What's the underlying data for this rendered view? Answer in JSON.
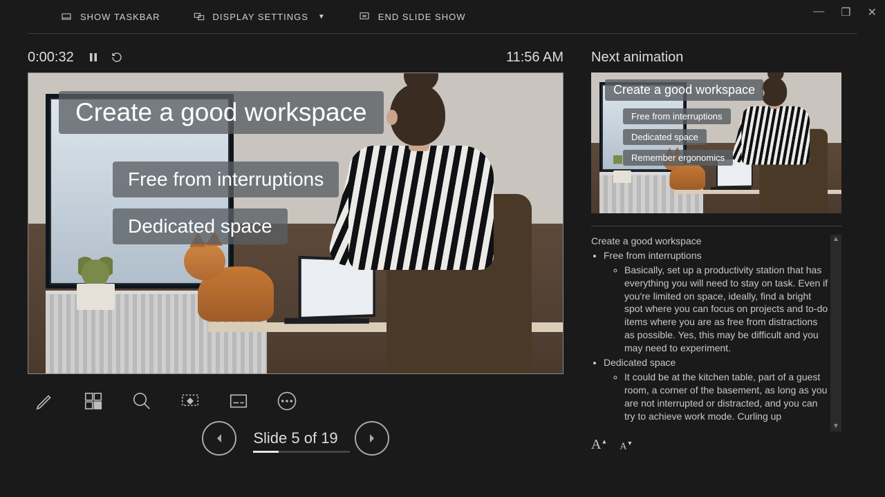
{
  "topbar": {
    "show_taskbar": "SHOW TASKBAR",
    "display_settings": "DISPLAY SETTINGS",
    "end_slide_show": "END SLIDE SHOW"
  },
  "timer": {
    "elapsed": "0:00:32"
  },
  "clock": "11:56 AM",
  "current_slide": {
    "title": "Create a good workspace",
    "bullets": [
      "Free from interruptions",
      "Dedicated space"
    ]
  },
  "next_animation_label": "Next animation",
  "next_slide": {
    "title": "Create a good workspace",
    "bullets": [
      "Free from interruptions",
      "Dedicated space",
      "Remember ergonomics"
    ]
  },
  "slide_counter": {
    "prefix": "Slide ",
    "current": 5,
    "sep": " of ",
    "total": 19
  },
  "notes": {
    "heading": "Create a good workspace",
    "items": [
      {
        "label": "Free from interruptions",
        "sub": [
          "Basically, set up a productivity station that has everything you will need to stay on task. Even if you're limited on space, ideally, find a bright spot where you can focus on projects and to-do items where you are as free from distractions as possible. Yes, this may be difficult and you may need to experiment."
        ]
      },
      {
        "label": "Dedicated space",
        "sub": [
          "It could be at the kitchen table, part of a guest room, a corner of the basement, as long as you are not interrupted or distracted, and you can try to achieve work mode. Curling up"
        ]
      }
    ]
  }
}
